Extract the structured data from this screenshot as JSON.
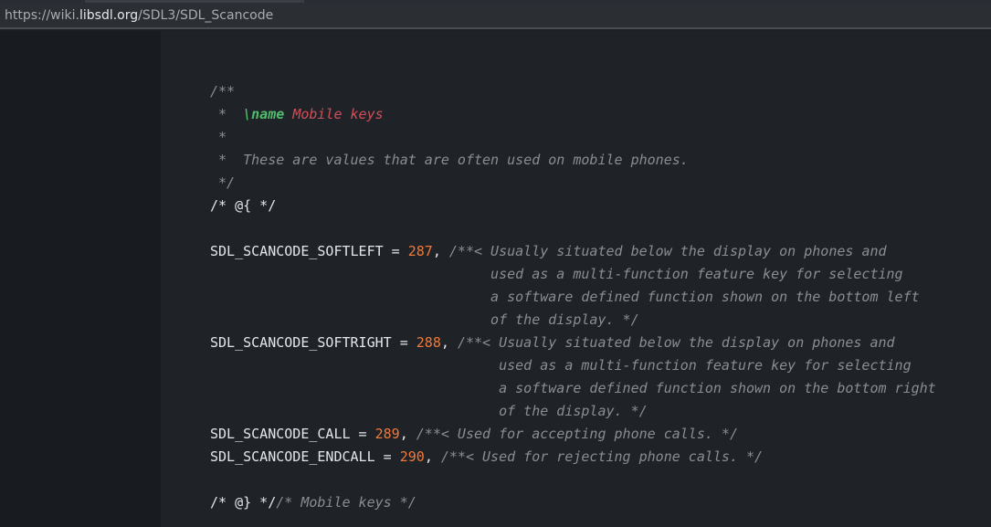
{
  "browser": {
    "url_scheme": "https://wiki.",
    "url_host": "libsdl.org",
    "url_path": "/SDL3/SDL_Scancode"
  },
  "code": {
    "doc_open": "/**",
    "doc_star_prefix": " *  ",
    "doc_name_cmd": "\\name",
    "doc_name_text": "Mobile keys",
    "doc_blank": " *",
    "doc_desc": " *  These are values that are often used on mobile phones.",
    "doc_close": " */",
    "group_open": "/* @{ */",
    "softleft_name": "SDL_SCANCODE_SOFTLEFT = ",
    "softleft_value": "287",
    "softleft_comment_1": "/**< Usually situated below the display on phones and",
    "softleft_comment_2": "                                  used as a multi-function feature key for selecting",
    "softleft_comment_3": "                                  a software defined function shown on the bottom left",
    "softleft_comment_4": "                                  of the display. */",
    "softright_name": "SDL_SCANCODE_SOFTRIGHT = ",
    "softright_value": "288",
    "softright_comment_1": "/**< Usually situated below the display on phones and",
    "softright_comment_2": "                                   used as a multi-function feature key for selecting",
    "softright_comment_3": "                                   a software defined function shown on the bottom right",
    "softright_comment_4": "                                   of the display. */",
    "call_name": "SDL_SCANCODE_CALL = ",
    "call_value": "289",
    "call_comment": "/**< Used for accepting phone calls. */",
    "endcall_name": "SDL_SCANCODE_ENDCALL = ",
    "endcall_value": "290",
    "endcall_comment": "/**< Used for rejecting phone calls. */",
    "comma": ", ",
    "group_close": "/* @} */",
    "group_close_comment": "/* Mobile keys */"
  },
  "colors": {
    "comment": "#8a8d92",
    "number": "#ef7a3a",
    "doc_keyword": "#4fbd6d",
    "doc_name": "#d0505a",
    "text": "#e4e6ea"
  }
}
